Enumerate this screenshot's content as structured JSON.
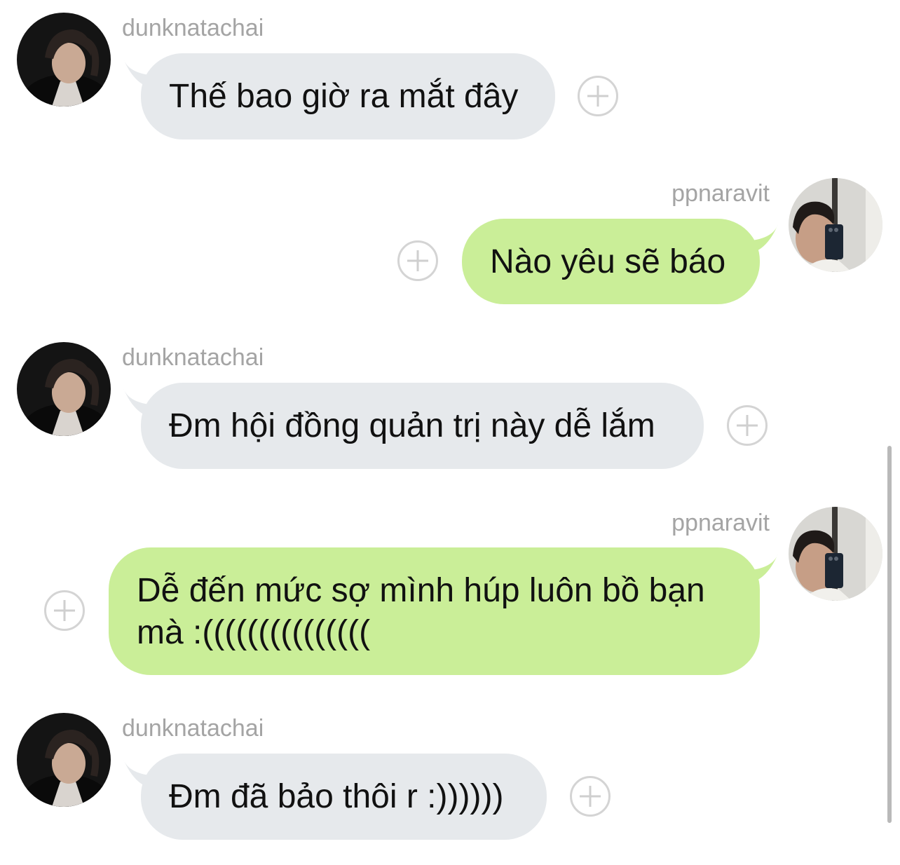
{
  "messages": [
    {
      "sender": "dunknatachai",
      "text": "Thế bao giờ ra mắt đây",
      "direction": "incoming"
    },
    {
      "sender": "ppnaravit",
      "text": "Nào yêu sẽ báo",
      "direction": "outgoing"
    },
    {
      "sender": "dunknatachai",
      "text": "Đm hội đồng quản trị này dễ lắm",
      "direction": "incoming"
    },
    {
      "sender": "ppnaravit",
      "text": "Dễ đến mức sợ mình húp luôn bồ bạn mà :(((((((((((((((",
      "direction": "outgoing"
    },
    {
      "sender": "dunknatachai",
      "text": "Đm đã bảo thôi r :))))))",
      "direction": "incoming"
    }
  ],
  "icons": {
    "reaction": "add-reaction-icon",
    "avatar_incoming": "avatar-dunknatachai",
    "avatar_outgoing": "avatar-ppnaravit"
  },
  "colors": {
    "incoming_bubble": "#e6e9ec",
    "outgoing_bubble": "#caee98",
    "sender_name": "#a4a4a4",
    "text": "#111111"
  }
}
